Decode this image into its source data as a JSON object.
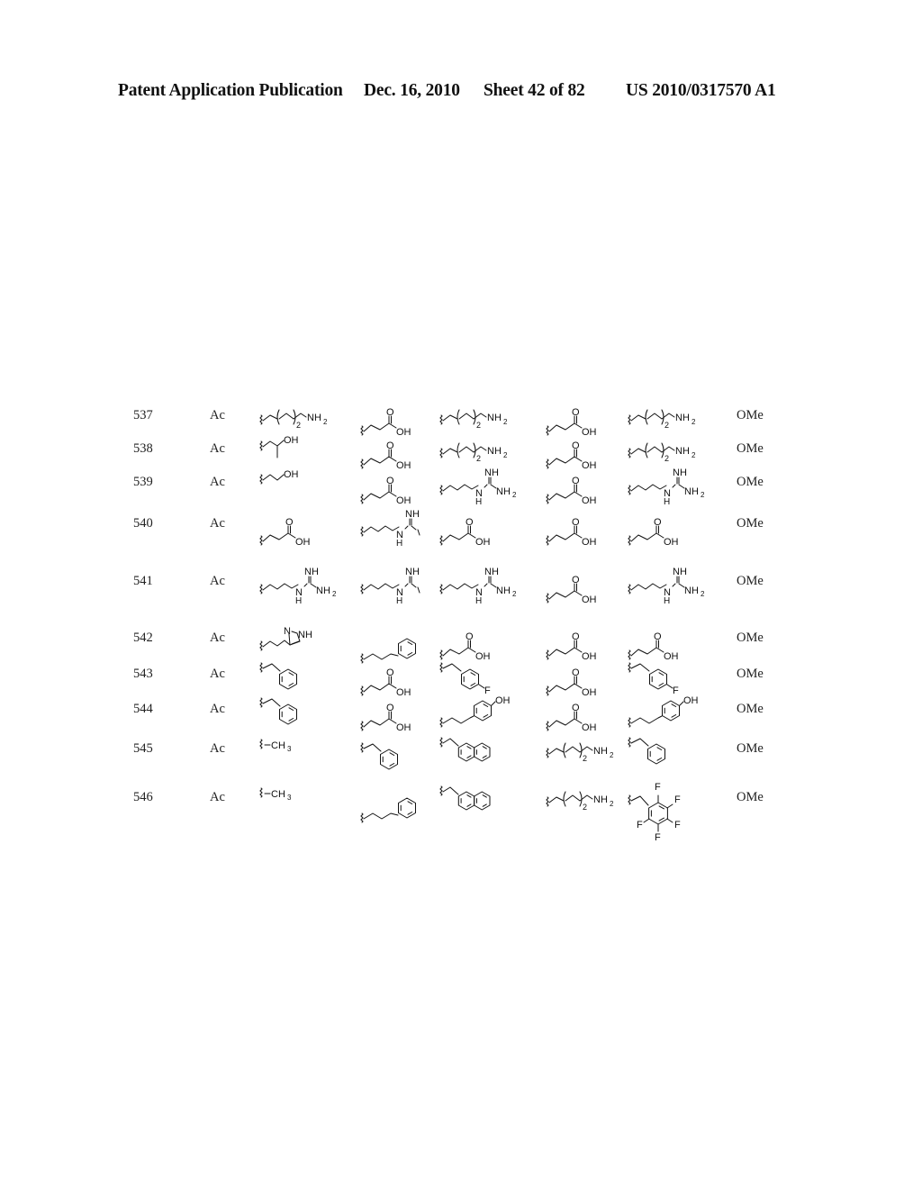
{
  "header": {
    "title": "Patent Application Publication",
    "date": "Dec. 16, 2010",
    "sheet": "Sheet 42 of 82",
    "publication_number": "US 2010/0317570 A1"
  },
  "table": {
    "rows": [
      {
        "id": "537",
        "r1": "Ac",
        "cols": [
          "aminobutyl-n2",
          "propanoic-acid",
          "aminobutyl-n2",
          "propanoic-acid",
          "aminobutyl-n2"
        ],
        "r_end": "OMe"
      },
      {
        "id": "538",
        "r1": "Ac",
        "cols": [
          "2-hydroxypropyl",
          "propanoic-acid",
          "aminobutyl-n2",
          "propanoic-acid",
          "aminobutyl-n2"
        ],
        "r_end": "OMe"
      },
      {
        "id": "539",
        "r1": "Ac",
        "cols": [
          "hydroxyethyl",
          "propanoic-acid",
          "guanidinopropyl",
          "propanoic-acid",
          "guanidinopropyl"
        ],
        "r_end": "OMe"
      },
      {
        "id": "540",
        "r1": "Ac",
        "cols": [
          "propanoic-acid",
          "guanidinopropyl-truncated",
          "propanoic-acid",
          "propanoic-acid",
          "propanoic-acid"
        ],
        "r_end": "OMe"
      },
      {
        "id": "541",
        "r1": "Ac",
        "cols": [
          "guanidinopropyl",
          "guanidinopropyl-truncated",
          "guanidinopropyl",
          "propanoic-acid",
          "guanidinopropyl"
        ],
        "r_end": "OMe"
      },
      {
        "id": "542",
        "r1": "Ac",
        "cols": [
          "imidazolylethyl",
          "phenylethyl",
          "propanoic-acid",
          "propanoic-acid",
          "propanoic-acid"
        ],
        "r_end": "OMe"
      },
      {
        "id": "543",
        "r1": "Ac",
        "cols": [
          "benzyl",
          "propanoic-acid",
          "4-fluorobenzyl",
          "propanoic-acid",
          "4-fluorobenzyl"
        ],
        "r_end": "OMe"
      },
      {
        "id": "544",
        "r1": "Ac",
        "cols": [
          "benzyl",
          "propanoic-acid",
          "4-hydroxyphenylethyl",
          "propanoic-acid",
          "4-hydroxyphenylethyl"
        ],
        "r_end": "OMe"
      },
      {
        "id": "545",
        "r1": "Ac",
        "cols": [
          "methyl",
          "benzyl",
          "2-naphthylmethyl",
          "aminobutyl-n2",
          "benzyl"
        ],
        "r_end": "OMe"
      },
      {
        "id": "546",
        "r1": "Ac",
        "cols": [
          "methyl",
          "phenylethyl",
          "2-naphthylmethyl",
          "aminobutyl-n2",
          "pentafluorobenzyl"
        ],
        "r_end": "OMe"
      }
    ]
  },
  "labels": {
    "NH2": "NH",
    "sub2": "2",
    "OH": "OH",
    "O": "O",
    "NH": "NH",
    "N": "N",
    "H": "H",
    "F": "F",
    "CH3": "CH",
    "sub3": "3",
    "ring_N": "N",
    "ring_NH": "NH"
  }
}
